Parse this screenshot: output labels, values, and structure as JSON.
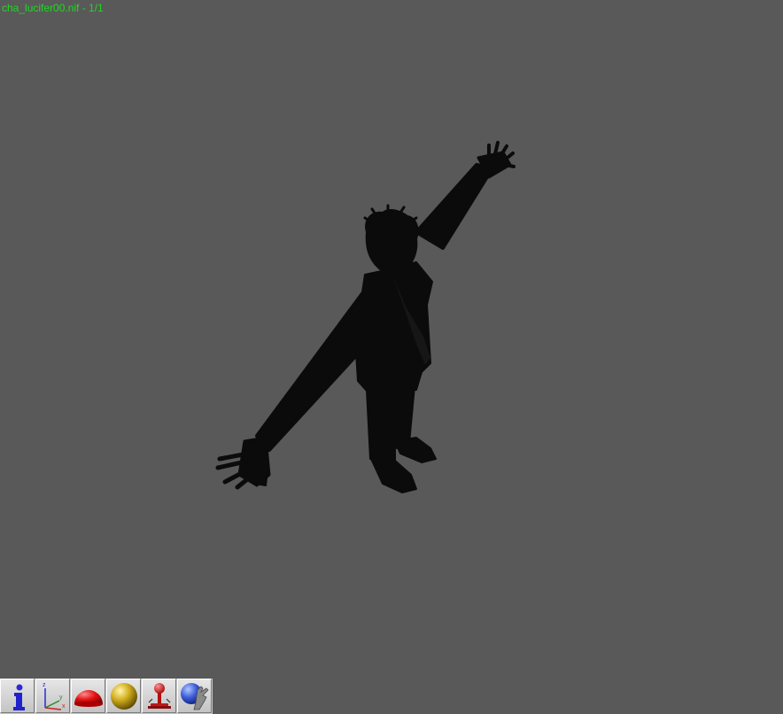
{
  "viewer": {
    "file_label": "cha_lucifer00.nif - 1/1",
    "background_color": "#595959",
    "label_color": "#22d622",
    "model_color": "#0b0b0b"
  },
  "toolbar": {
    "buttons": [
      {
        "id": "info",
        "icon": "info-icon"
      },
      {
        "id": "axes",
        "icon": "axes-icon"
      },
      {
        "id": "hemisphere",
        "icon": "red-hemisphere-icon"
      },
      {
        "id": "sphere",
        "icon": "gold-sphere-icon"
      },
      {
        "id": "joystick",
        "icon": "joystick-icon"
      },
      {
        "id": "globe-hand",
        "icon": "globe-hand-icon"
      }
    ]
  }
}
